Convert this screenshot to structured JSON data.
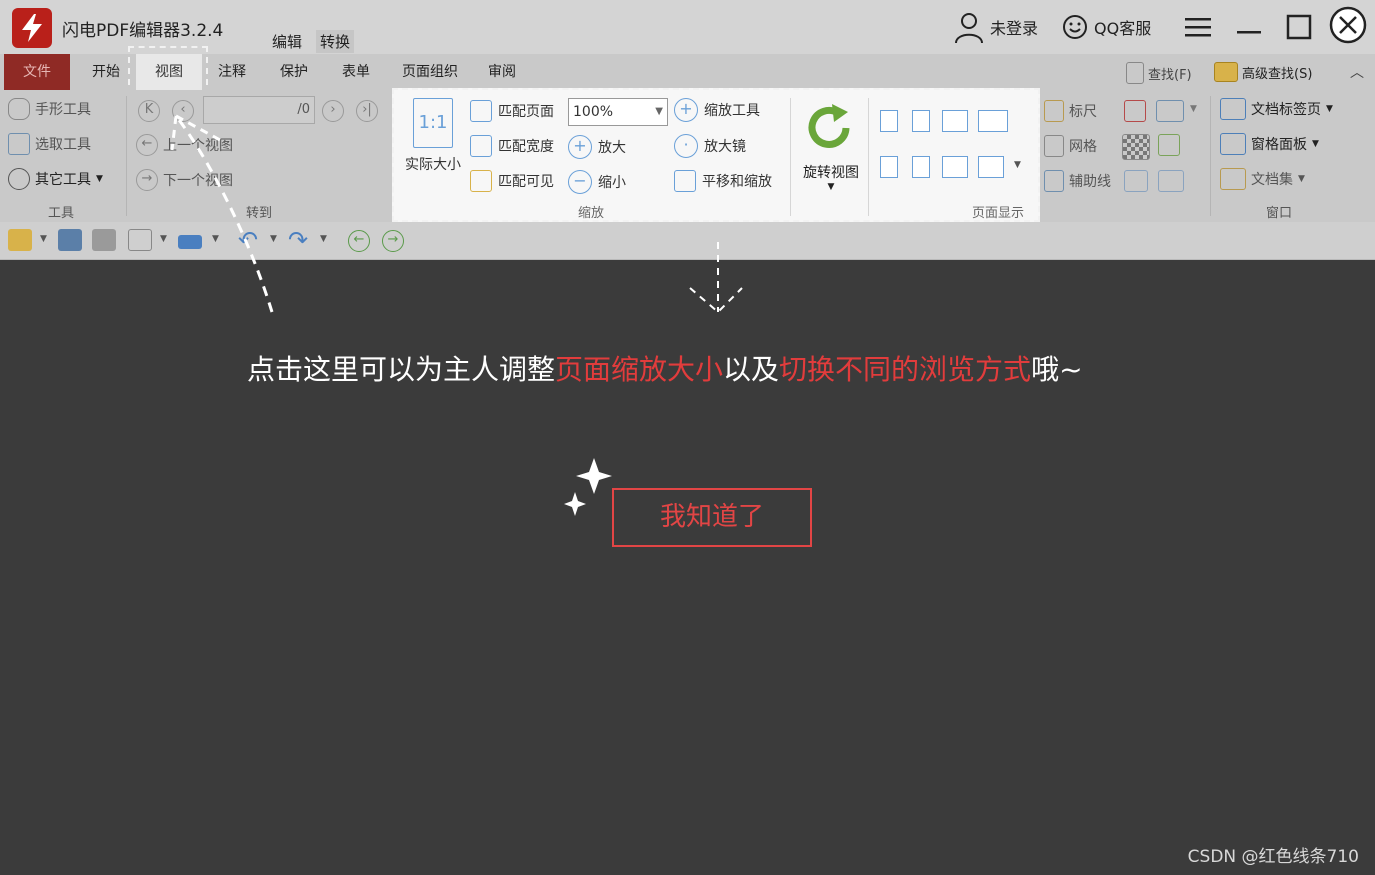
{
  "app": {
    "title": "闪电PDF编辑器3.2.4",
    "top_tabs": [
      "编辑",
      "转换"
    ],
    "user": "未登录",
    "support": "QQ客服"
  },
  "ribbon_tabs": {
    "file": "文件",
    "start": "开始",
    "view": "视图",
    "annotate": "注释",
    "protect": "保护",
    "form": "表单",
    "page_org": "页面组织",
    "review": "审阅",
    "find": "查找(F)",
    "advanced_find": "高级查找(S)"
  },
  "tools_group": {
    "hand": "手形工具",
    "select": "选取工具",
    "other": "其它工具",
    "label": "工具"
  },
  "goto_group": {
    "page_value": "/0",
    "prev_view": "上一个视图",
    "next_view": "下一个视图",
    "label": "转到"
  },
  "zoom_group": {
    "actual_size": "实际大小",
    "actual_glyph": "1:1",
    "fit_page": "匹配页面",
    "fit_width": "匹配宽度",
    "fit_visible": "匹配可见",
    "zoom_value": "100%",
    "zoom_in": "放大",
    "zoom_out": "缩小",
    "zoom_tool": "缩放工具",
    "magnifier": "放大镜",
    "pan_zoom": "平移和缩放",
    "label": "缩放"
  },
  "rotate": {
    "label": "旋转视图"
  },
  "page_display": {
    "label": "页面显示"
  },
  "aux_group": {
    "ruler": "标尺",
    "grid": "网格",
    "guides": "辅助线"
  },
  "window_group": {
    "doc_tabs": "文档标签页",
    "pane_panel": "窗格面板",
    "doc_set": "文档集",
    "label": "窗口"
  },
  "overlay": {
    "hint_part1": "点击这里可以为主人调整",
    "hint_red1": "页面缩放大小",
    "hint_part2": "以及",
    "hint_red2": "切换不同的浏览方式",
    "hint_part3": "哦~",
    "button": "我知道了"
  },
  "watermark": "CSDN @红色线条710",
  "colors": {
    "accent_red": "#e23c3c",
    "file_tab": "#8f2a25",
    "overlay_bg": "#3b3b3b",
    "icon_blue": "#6aa0d8"
  }
}
